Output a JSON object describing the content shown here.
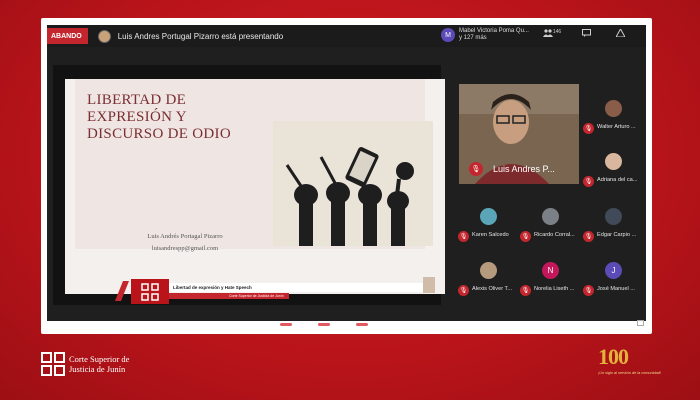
{
  "topbar": {
    "recording_label": "ABANDO",
    "presenting_text": "Luis Andres Portugal Pizarro está presentando",
    "participants_chip": {
      "avatar_letter": "M",
      "line1": "Mabel Victoria Poma Qu...",
      "line2": "y 127 más"
    },
    "icons": [
      {
        "icon": "people-icon",
        "badge": "146"
      },
      {
        "icon": "chat-icon",
        "badge": ""
      },
      {
        "icon": "activities-icon",
        "badge": ""
      },
      {
        "icon": "lock-icon",
        "badge": ""
      }
    ]
  },
  "slide": {
    "title_line1": "LIBERTAD DE",
    "title_line2": "EXPRESIÓN Y",
    "title_line3": "DISCURSO DE ODIO",
    "author_name": "Luis Andrés Portagal Pizarro",
    "author_email": "luisandrespp@gmail.com",
    "lower_third_title": "Libertad de expresión y Hate Speech",
    "lower_third_sub": "Corte Superior de Justicia de Junín"
  },
  "speaker": {
    "name": "Luis Andres P..."
  },
  "participants": [
    {
      "name": "Walter Arturo ...",
      "avatar": "photo",
      "color": "#8a5d49"
    },
    {
      "name": "Adriana del ca...",
      "avatar": "photo",
      "color": "#d8b79e"
    },
    {
      "name": "Karen Salcedo",
      "avatar": "photo",
      "color": "#5aa6b8"
    },
    {
      "name": "Ricardo Corral...",
      "avatar": "photo",
      "color": "#7b7f86"
    },
    {
      "name": "Edgar Carpio ...",
      "avatar": "photo",
      "color": "#404a58"
    },
    {
      "name": "Alexis Oliver T...",
      "avatar": "photo",
      "color": "#b69a7e"
    },
    {
      "name": "Norelia Liseth ...",
      "avatar": "N",
      "color": "#c2185b"
    },
    {
      "name": "José Manuel ...",
      "avatar": "J",
      "color": "#5b4bb7"
    }
  ],
  "footer": {
    "org_line1": "Corte Superior de",
    "org_line2": "Justicia de Junín",
    "anniversary_number": "100",
    "anniversary_tagline": "¡Un siglo al servicio de la comunidad!"
  }
}
